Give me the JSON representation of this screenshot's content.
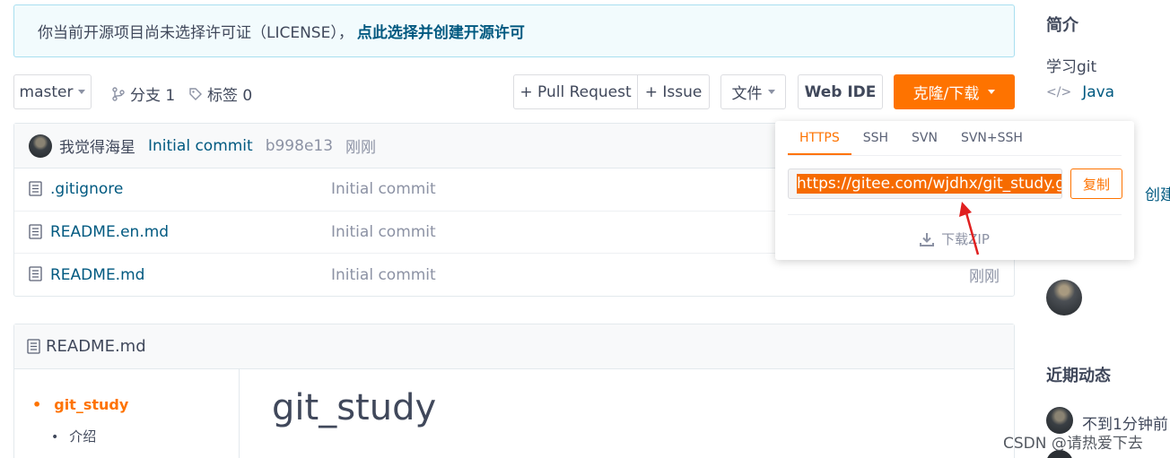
{
  "license_banner": {
    "text": "你当前开源项目尚未选择许可证（LICENSE），",
    "link": "点此选择并创建开源许可"
  },
  "toolbar": {
    "branch": "master",
    "branches": "分支 1",
    "tags": "标签 0",
    "pull_request": "+ Pull Request",
    "issue": "+ Issue",
    "file": "文件",
    "web_ide": "Web IDE",
    "clone": "克隆/下载"
  },
  "commit": {
    "author": "我觉得海星",
    "message": "Initial commit",
    "sha": "b998e13",
    "time": "刚刚"
  },
  "files": [
    {
      "name": ".gitignore",
      "message": "Initial commit",
      "time": ""
    },
    {
      "name": "README.en.md",
      "message": "Initial commit",
      "time": ""
    },
    {
      "name": "README.md",
      "message": "Initial commit",
      "time": "刚刚"
    }
  ],
  "readme": {
    "header": "README.md",
    "toc": [
      "git_study",
      "介绍"
    ],
    "title": "git_study"
  },
  "clone_panel": {
    "tabs": [
      "HTTPS",
      "SSH",
      "SVN",
      "SVN+SSH"
    ],
    "active_tab": "HTTPS",
    "url": "https://gitee.com/wjdhx/git_study.git",
    "copy": "复制",
    "download_zip": "下载ZIP"
  },
  "sidebar": {
    "intro_title": "简介",
    "intro_text": "学习git",
    "language": "Java",
    "create_link": "创建",
    "recent_title": "近期动态",
    "recent_item": "不到1分钟前"
  },
  "watermark": "CSDN @请热爱下去",
  "colors": {
    "accent": "#fe7300",
    "link": "#005980",
    "banner_bg": "#f2fbfd",
    "selection": "#f66b00",
    "annotation_arrow": "#e02020"
  }
}
